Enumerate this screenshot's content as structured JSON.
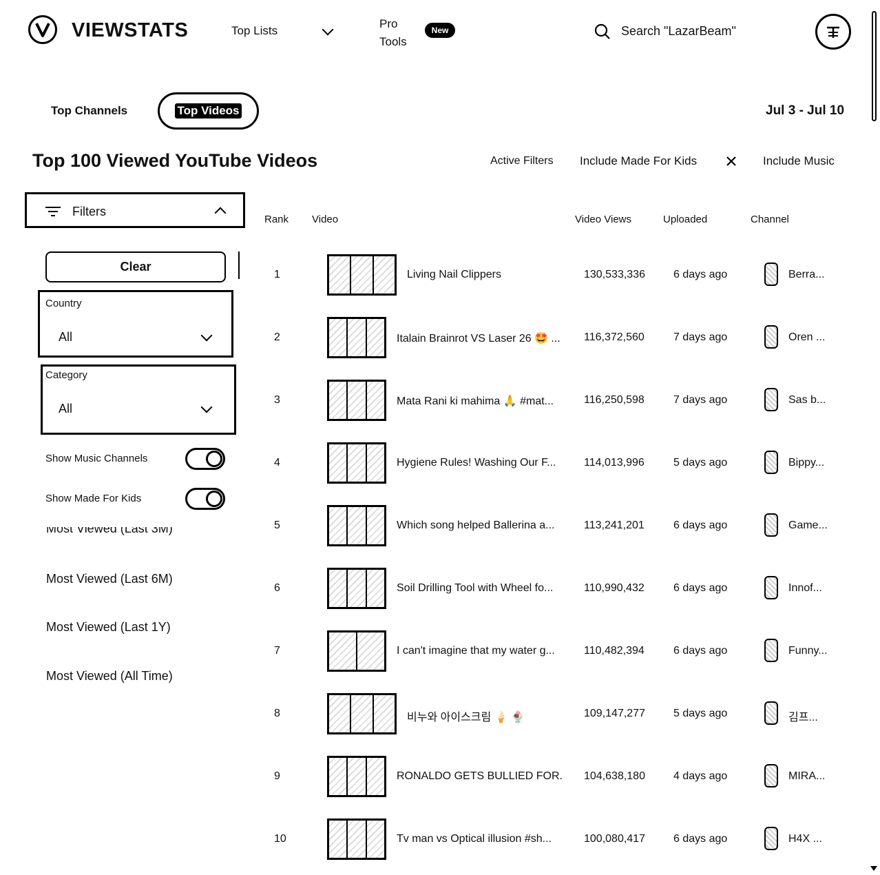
{
  "header": {
    "logo_text": "VIEWSTATS",
    "nav_top_lists": "Top Lists",
    "nav_pro_line1": "Pro",
    "nav_pro_line2": "Tools",
    "new_badge": "New",
    "search_placeholder": "Search \"LazarBeam\""
  },
  "tabs": {
    "top_channels": "Top Channels",
    "top_videos": "Top Videos"
  },
  "date_range": "Jul 3 - Jul 10",
  "page_title": "Top 100 Viewed YouTube Videos",
  "active_filters": {
    "label": "Active Filters",
    "chips": [
      "Include Made For Kids",
      "Include Music"
    ]
  },
  "filters": {
    "title": "Filters",
    "clear": "Clear",
    "country_label": "Country",
    "country_value": "All",
    "category_label": "Category",
    "category_value": "All",
    "show_music_channels": "Show Music Channels",
    "show_made_for_kids": "Show Made For Kids",
    "most_viewed_options": [
      "Most Viewed (Last 3M)",
      "Most Viewed (Last 6M)",
      "Most Viewed (Last 1Y)",
      "Most Viewed (All Time)"
    ]
  },
  "table": {
    "headers": {
      "rank": "Rank",
      "video": "Video",
      "views": "Video Views",
      "uploaded": "Uploaded",
      "channel": "Channel"
    },
    "rows": [
      {
        "rank": "1",
        "title": "Living Nail Clippers",
        "views": "130,533,336",
        "uploaded": "6 days ago",
        "channel": "Berra..."
      },
      {
        "rank": "2",
        "title": "Italain Brainrot VS Laser 26 🤩 ...",
        "views": "116,372,560",
        "uploaded": "7 days ago",
        "channel": "Oren ..."
      },
      {
        "rank": "3",
        "title": "Mata Rani ki mahima 🙏 #mat...",
        "views": "116,250,598",
        "uploaded": "7 days ago",
        "channel": "Sas b..."
      },
      {
        "rank": "4",
        "title": "Hygiene Rules! Washing Our F...",
        "views": "114,013,996",
        "uploaded": "5 days ago",
        "channel": "Bippy..."
      },
      {
        "rank": "5",
        "title": "Which song helped Ballerina a...",
        "views": "113,241,201",
        "uploaded": "6 days ago",
        "channel": "Game..."
      },
      {
        "rank": "6",
        "title": "Soil Drilling Tool with Wheel fo...",
        "views": "110,990,432",
        "uploaded": "6 days ago",
        "channel": "Innof..."
      },
      {
        "rank": "7",
        "title": "I can't imagine that my water g...",
        "views": "110,482,394",
        "uploaded": "6 days ago",
        "channel": "Funny..."
      },
      {
        "rank": "8",
        "title": "비누와 아이스크림 🍦 🍨",
        "views": "109,147,277",
        "uploaded": "5 days ago",
        "channel": "김프..."
      },
      {
        "rank": "9",
        "title": "RONALDO GETS BULLIED FOR...",
        "views": "104,638,180",
        "uploaded": "4 days ago",
        "channel": "MIRA..."
      },
      {
        "rank": "10",
        "title": "Tv man vs Optical illusion #sh...",
        "views": "100,080,417",
        "uploaded": "6 days ago",
        "channel": "H4X ..."
      }
    ]
  }
}
